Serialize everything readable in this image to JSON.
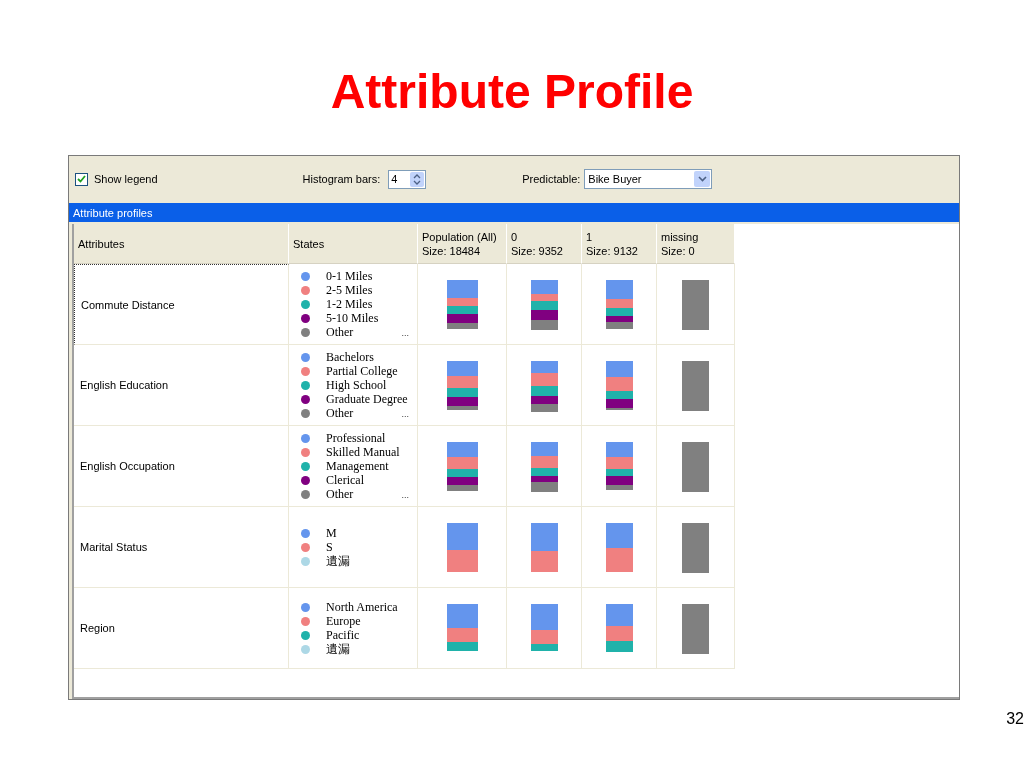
{
  "slide_title": "Attribute Profile",
  "toolbar": {
    "show_legend": {
      "label": "Show legend",
      "checked": true
    },
    "histogram_bars": {
      "label": "Histogram bars:",
      "value": "4"
    },
    "predictable": {
      "label": "Predictable:",
      "value": "Bike Buyer"
    }
  },
  "panel_title": "Attribute profiles",
  "columns": [
    {
      "title": "Attributes"
    },
    {
      "title": "States"
    },
    {
      "title": "Population (All)",
      "size": "Size: 18484",
      "kind": "histogram"
    },
    {
      "title": "0",
      "size": "Size: 9352",
      "kind": "histogram"
    },
    {
      "title": "1",
      "size": "Size: 9132",
      "kind": "histogram"
    },
    {
      "title": "missing",
      "size": "Size: 0",
      "kind": "missing"
    }
  ],
  "rows": [
    {
      "attribute": "Commute Distance",
      "selected": true,
      "more": "...",
      "states": [
        {
          "label": "0-1 Miles",
          "color": "#6495ed"
        },
        {
          "label": "2-5 Miles",
          "color": "#f08080"
        },
        {
          "label": "1-2 Miles",
          "color": "#20b2aa"
        },
        {
          "label": "5-10 Miles",
          "color": "#800080"
        },
        {
          "label": "Other",
          "color": "#808080"
        }
      ]
    },
    {
      "attribute": "English Education",
      "selected": false,
      "more": "...",
      "states": [
        {
          "label": "Bachelors",
          "color": "#6495ed"
        },
        {
          "label": "Partial College",
          "color": "#f08080"
        },
        {
          "label": "High School",
          "color": "#20b2aa"
        },
        {
          "label": "Graduate Degree",
          "color": "#800080"
        },
        {
          "label": "Other",
          "color": "#808080"
        }
      ]
    },
    {
      "attribute": "English Occupation",
      "selected": false,
      "more": "...",
      "states": [
        {
          "label": "Professional",
          "color": "#6495ed"
        },
        {
          "label": "Skilled Manual",
          "color": "#f08080"
        },
        {
          "label": "Management",
          "color": "#20b2aa"
        },
        {
          "label": "Clerical",
          "color": "#800080"
        },
        {
          "label": "Other",
          "color": "#808080"
        }
      ]
    },
    {
      "attribute": "Marital Status",
      "selected": false,
      "states": [
        {
          "label": "M",
          "color": "#6495ed"
        },
        {
          "label": "S",
          "color": "#f08080"
        },
        {
          "label": "遺漏",
          "color": "#add8e6"
        }
      ]
    },
    {
      "attribute": "Region",
      "selected": false,
      "states": [
        {
          "label": "North America",
          "color": "#6495ed"
        },
        {
          "label": "Europe",
          "color": "#f08080"
        },
        {
          "label": "Pacific",
          "color": "#20b2aa"
        },
        {
          "label": "遺漏",
          "color": "#add8e6"
        }
      ]
    }
  ],
  "page_number": "32"
}
